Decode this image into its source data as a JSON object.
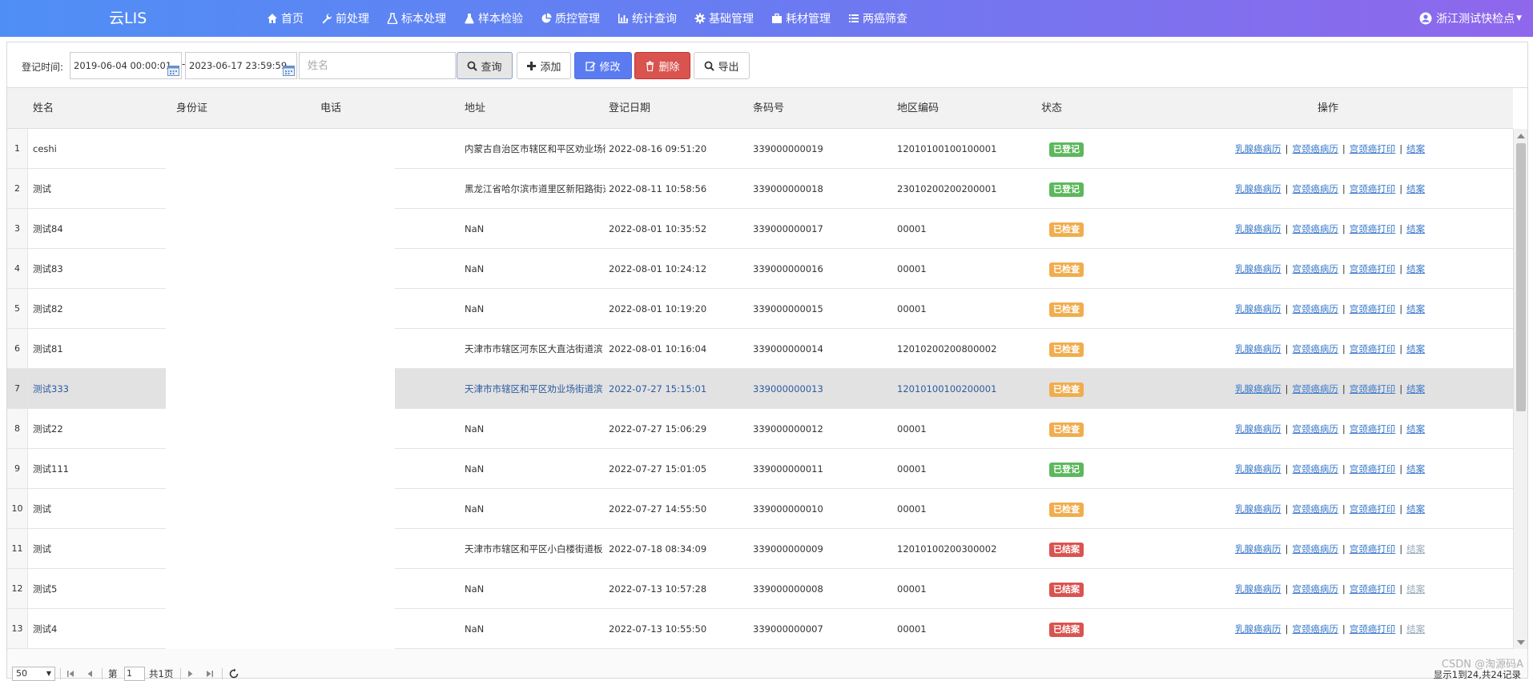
{
  "app": {
    "brand": "云LIS"
  },
  "nav": [
    {
      "label": "首页",
      "icon": "home-icon"
    },
    {
      "label": "前处理",
      "icon": "wrench-icon"
    },
    {
      "label": "标本处理",
      "icon": "flask-icon"
    },
    {
      "label": "样本检验",
      "icon": "beaker-icon"
    },
    {
      "label": "质控管理",
      "icon": "pie-chart-icon"
    },
    {
      "label": "统计查询",
      "icon": "bar-chart-icon"
    },
    {
      "label": "基础管理",
      "icon": "gear-icon"
    },
    {
      "label": "耗材管理",
      "icon": "briefcase-icon"
    },
    {
      "label": "两癌筛查",
      "icon": "list-icon"
    }
  ],
  "user": {
    "name": "浙江测试快检点",
    "icon": "user-circle-icon"
  },
  "toolbar": {
    "date_label": "登记时间:",
    "date_from": "2019-06-04 00:00:01",
    "date_to": "2023-06-17 23:59:59",
    "separator": "-",
    "name_placeholder": "姓名",
    "query_label": "查询",
    "add_label": "添加",
    "edit_label": "修改",
    "delete_label": "删除",
    "export_label": "导出"
  },
  "columns": [
    "姓名",
    "身份证",
    "电话",
    "地址",
    "登记日期",
    "条码号",
    "地区编码",
    "状态",
    "操作"
  ],
  "status_colors": {
    "已登记": "#5cb85c",
    "已检查": "#f0ad4e",
    "已结案": "#d9534f"
  },
  "ops_labels": {
    "breast": "乳腺癌病历",
    "cervical": "宫颈癌病历",
    "print": "宫颈癌打印",
    "close": "结案",
    "sep": "|"
  },
  "rows": [
    {
      "no": "1",
      "name": "ceshi",
      "address": "内蒙古自治区市辖区和平区劝业场街道",
      "date": "2022-08-16 09:51:20",
      "barcode": "339000000019",
      "region": "12010100100100001",
      "status": "已登记",
      "status_kind": "reg",
      "close_enabled": true
    },
    {
      "no": "2",
      "name": "测试",
      "address": "黑龙江省哈尔滨市道里区新阳路街道",
      "date": "2022-08-11 10:58:56",
      "barcode": "339000000018",
      "region": "23010200200200001",
      "status": "已登记",
      "status_kind": "reg",
      "close_enabled": true
    },
    {
      "no": "3",
      "name": "测试84",
      "address": "NaN",
      "date": "2022-08-01 10:35:52",
      "barcode": "339000000017",
      "region": "00001",
      "status": "已检查",
      "status_kind": "chk",
      "close_enabled": true
    },
    {
      "no": "4",
      "name": "测试83",
      "address": "NaN",
      "date": "2022-08-01 10:24:12",
      "barcode": "339000000016",
      "region": "00001",
      "status": "已检查",
      "status_kind": "chk",
      "close_enabled": true
    },
    {
      "no": "5",
      "name": "测试82",
      "address": "NaN",
      "date": "2022-08-01 10:19:20",
      "barcode": "339000000015",
      "region": "00001",
      "status": "已检查",
      "status_kind": "chk",
      "close_enabled": true
    },
    {
      "no": "6",
      "name": "测试81",
      "address": "天津市市辖区河东区大直沽街道滨",
      "date": "2022-08-01 10:16:04",
      "barcode": "339000000014",
      "region": "12010200200800002",
      "status": "已检查",
      "status_kind": "chk",
      "close_enabled": true
    },
    {
      "no": "7",
      "name": "测试333",
      "address": "天津市市辖区和平区劝业场街道滨",
      "date": "2022-07-27 15:15:01",
      "barcode": "339000000013",
      "region": "12010100100200001",
      "status": "已检查",
      "status_kind": "chk",
      "close_enabled": true,
      "selected": true
    },
    {
      "no": "8",
      "name": "测试22",
      "address": "NaN",
      "date": "2022-07-27 15:06:29",
      "barcode": "339000000012",
      "region": "00001",
      "status": "已检查",
      "status_kind": "chk",
      "close_enabled": true
    },
    {
      "no": "9",
      "name": "测试111",
      "address": "NaN",
      "date": "2022-07-27 15:01:05",
      "barcode": "339000000011",
      "region": "00001",
      "status": "已登记",
      "status_kind": "reg",
      "close_enabled": true
    },
    {
      "no": "10",
      "name": "测试",
      "address": "NaN",
      "date": "2022-07-27 14:55:50",
      "barcode": "339000000010",
      "region": "00001",
      "status": "已检查",
      "status_kind": "chk",
      "close_enabled": true
    },
    {
      "no": "11",
      "name": "测试",
      "address": "天津市市辖区和平区小白楼街道板",
      "date": "2022-07-18 08:34:09",
      "barcode": "339000000009",
      "region": "12010100200300002",
      "status": "已结案",
      "status_kind": "done",
      "close_enabled": false
    },
    {
      "no": "12",
      "name": "测试5",
      "address": "NaN",
      "date": "2022-07-13 10:57:28",
      "barcode": "339000000008",
      "region": "00001",
      "status": "已结案",
      "status_kind": "done",
      "close_enabled": false
    },
    {
      "no": "13",
      "name": "测试4",
      "address": "NaN",
      "date": "2022-07-13 10:55:50",
      "barcode": "339000000007",
      "region": "00001",
      "status": "已结案",
      "status_kind": "done",
      "close_enabled": false
    }
  ],
  "pager": {
    "page_size": "50",
    "page_prefix": "第",
    "page_number": "1",
    "page_total": "共1页",
    "summary": "显示1到24,共24记录"
  },
  "watermark": "CSDN @淘源码A"
}
